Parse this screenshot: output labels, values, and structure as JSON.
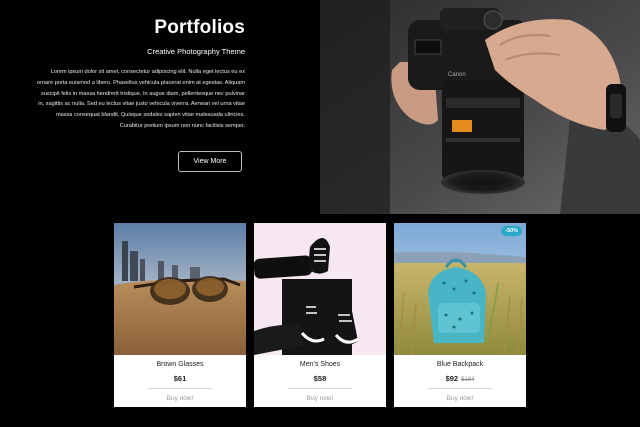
{
  "hero": {
    "title": "Portfolios",
    "subtitle": "Creative Photography Theme",
    "body": "Lorem ipsum dolor sit amet, consectetur adipiscing elit. Nulla eget lectus eu ex ornare porta euismod a libero. Phasellus vehicula placerat enim at egestas. Aliquam suscipit felis in massa hendrerit tristique. In augue diam, pellentesque nec pulvinar in, sagittis ac nulla. Sed eu lectus vitae justo vehicula viverra. Aenean vel urna vitae massa consequat blandit. Quisque sodales sapien vitae malesuada ultricies. Curabitur pretium ipsum non nunc facilisis semper.",
    "button_label": "View More",
    "camera_brand": "Canon"
  },
  "products": [
    {
      "name": "Brown Glasses",
      "price": "$61",
      "old_price": "",
      "badge": "",
      "cta": "Buy now!"
    },
    {
      "name": "Men's Shoes",
      "price": "$58",
      "old_price": "",
      "badge": "",
      "cta": "Buy now!"
    },
    {
      "name": "Blue Backpack",
      "price": "$92",
      "old_price": "$184",
      "badge": "-50%",
      "cta": "Buy now!"
    }
  ],
  "colors": {
    "background": "#000000",
    "badge": "#29a9c8",
    "card": "#ffffff"
  }
}
